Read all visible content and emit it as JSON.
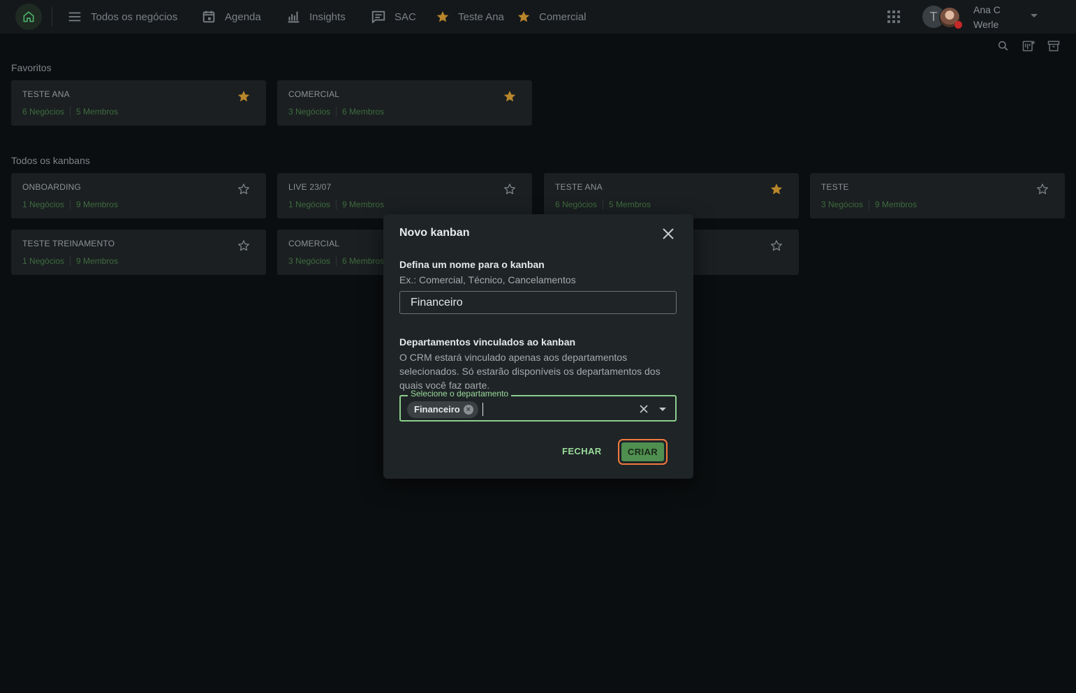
{
  "nav": {
    "items": [
      {
        "label": "Todos os negócios",
        "icon": "menu-icon"
      },
      {
        "label": "Agenda",
        "icon": "calendar-icon"
      },
      {
        "label": "Insights",
        "icon": "bar-chart-icon"
      },
      {
        "label": "SAC",
        "icon": "chat-icon"
      },
      {
        "label": "Teste Ana",
        "icon": "star-filled-icon"
      },
      {
        "label": "Comercial",
        "icon": "star-filled-icon"
      }
    ],
    "avatar_initial": "T",
    "user_name": "Ana C Werle"
  },
  "favorites": {
    "title": "Favoritos",
    "cards": [
      {
        "title": "TESTE ANA",
        "deals": "6 Negócios",
        "members": "5 Membros",
        "starred": true
      },
      {
        "title": "COMERCIAL",
        "deals": "3 Negócios",
        "members": "6 Membros",
        "starred": true
      }
    ]
  },
  "all_kanbans": {
    "title": "Todos os kanbans",
    "cards": [
      {
        "title": "ONBOARDING",
        "deals": "1 Negócios",
        "members": "9 Membros",
        "starred": false
      },
      {
        "title": "LIVE 23/07",
        "deals": "1 Negócios",
        "members": "9 Membros",
        "starred": false
      },
      {
        "title": "TESTE ANA",
        "deals": "6 Negócios",
        "members": "5 Membros",
        "starred": true
      },
      {
        "title": "TESTE",
        "deals": "3 Negócios",
        "members": "9 Membros",
        "starred": false
      },
      {
        "title": "TESTE TREINAMENTO",
        "deals": "1 Negócios",
        "members": "9 Membros",
        "starred": false
      },
      {
        "title": "COMERCIAL",
        "deals": "3 Negócios",
        "members": "6 Membros",
        "starred": false
      },
      {
        "title": "",
        "deals": "",
        "members": "",
        "starred": false
      }
    ]
  },
  "modal": {
    "title": "Novo kanban",
    "name_label": "Defina um nome para o kanban",
    "name_help": "Ex.: Comercial, Técnico, Cancelamentos",
    "name_value": "Financeiro",
    "dept_label": "Departamentos vinculados ao kanban",
    "dept_help": "O CRM estará vinculado apenas aos departamentos selecionados. Só estarão disponíveis os departamentos dos quais você faz parte.",
    "dept_field_label": "Selecione o departamento",
    "dept_selected": "Financeiro",
    "close_button": "FECHAR",
    "create_button": "CRIAR"
  },
  "colors": {
    "accent_green": "#8ccf8c",
    "star_gold": "#b8862b",
    "focus_ring": "#f07a3e"
  }
}
